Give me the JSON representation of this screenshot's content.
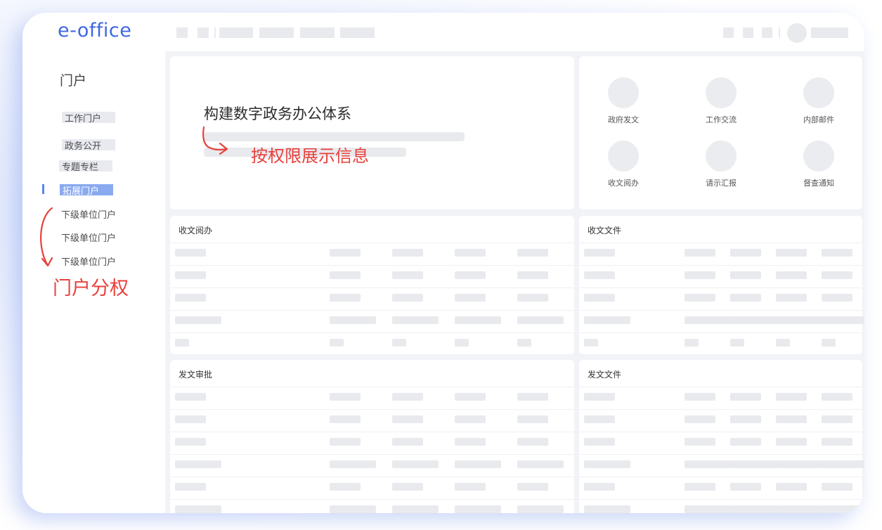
{
  "app": {
    "logo": "e-office"
  },
  "sidebar": {
    "title": "门户",
    "items": [
      {
        "label": "工作门户"
      },
      {
        "label": "政务公开"
      },
      {
        "label": "专题专栏"
      },
      {
        "label": "拓展门户",
        "active": true
      },
      {
        "label": "下级单位门户"
      },
      {
        "label": "下级单位门户"
      },
      {
        "label": "下级单位门户"
      }
    ]
  },
  "hero": {
    "title": "构建数字政务办公体系"
  },
  "quick_links": [
    {
      "label": "政府发文",
      "icon": "circle-icon"
    },
    {
      "label": "工作交流",
      "icon": "circle-icon"
    },
    {
      "label": "内部邮件",
      "icon": "circle-icon"
    },
    {
      "label": "收文阅办",
      "icon": "circle-icon"
    },
    {
      "label": "请示汇报",
      "icon": "circle-icon"
    },
    {
      "label": "督查通知",
      "icon": "circle-icon"
    }
  ],
  "panels": {
    "incoming_review": {
      "title": "收文阅办"
    },
    "incoming_files": {
      "title": "收文文件"
    },
    "outgoing_approval": {
      "title": "发文审批"
    },
    "outgoing_files": {
      "title": "发文文件"
    }
  },
  "annotations": {
    "permission_display": "按权限展示信息",
    "portal_permission": "门户分权"
  },
  "colors": {
    "brand": "#3f67e2",
    "active_item": "#8aaaf0",
    "annotation": "#e8413c",
    "placeholder": "#e9eaee"
  }
}
